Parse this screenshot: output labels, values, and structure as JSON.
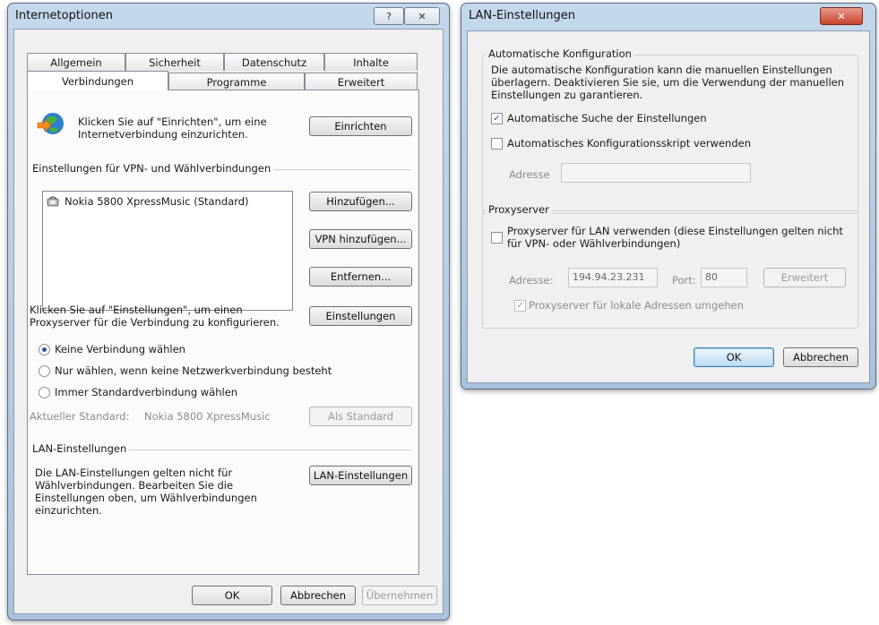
{
  "inet": {
    "title": "Internetoptionen",
    "help_glyph": "?",
    "close_glyph": "✕",
    "tabs_row1": [
      "Allgemein",
      "Sicherheit",
      "Datenschutz",
      "Inhalte"
    ],
    "tabs_row2": [
      "Verbindungen",
      "Programme",
      "Erweitert"
    ],
    "setup_text": "Klicken Sie auf \"Einrichten\", um eine Internetverbindung einzurichten.",
    "setup_button": "Einrichten",
    "vpn_group_title": "Einstellungen für VPN- und Wählverbindungen",
    "connection_item": "Nokia 5800 XpressMusic (Standard)",
    "add_button": "Hinzufügen...",
    "add_vpn_button": "VPN hinzufügen...",
    "remove_button": "Entfernen...",
    "settings_text": "Klicken Sie auf \"Einstellungen\", um einen Proxyserver für die Verbindung zu konfigurieren.",
    "settings_button": "Einstellungen",
    "radio_options": [
      "Keine Verbindung wählen",
      "Nur wählen, wenn keine Netzwerkverbindung besteht",
      "Immer Standardverbindung wählen"
    ],
    "selected_radio": 0,
    "current_default_label": "Aktueller Standard:",
    "current_default_value": "Nokia 5800 XpressMusic",
    "set_default_button": "Als Standard",
    "lan_group_title": "LAN-Einstellungen",
    "lan_text": "Die LAN-Einstellungen gelten nicht für Wählverbindungen. Bearbeiten Sie die Einstellungen oben, um Wählverbindungen einzurichten.",
    "lan_button": "LAN-Einstellungen",
    "ok_button": "OK",
    "cancel_button": "Abbrechen",
    "apply_button": "Übernehmen"
  },
  "lan": {
    "title": "LAN-Einstellungen",
    "close_glyph": "✕",
    "auto_group_title": "Automatische Konfiguration",
    "auto_text": "Die automatische Konfiguration kann die manuellen Einstellungen überlagern. Deaktivieren Sie sie, um die Verwendung der manuellen Einstellungen zu garantieren.",
    "auto_detect_label": "Automatische Suche der Einstellungen",
    "auto_detect_checked": true,
    "auto_script_label": "Automatisches Konfigurationsskript verwenden",
    "auto_script_checked": false,
    "address_label": "Adresse",
    "address_value": "",
    "proxy_group_title": "Proxyserver",
    "proxy_use_label": "Proxyserver für LAN verwenden (diese Einstellungen gelten nicht für VPN- oder Wählverbindungen)",
    "proxy_use_checked": false,
    "proxy_address_label": "Adresse:",
    "proxy_address_value": "194.94.23.231",
    "port_label": "Port:",
    "port_value": "80",
    "advanced_button": "Erweitert",
    "bypass_label": "Proxyserver für lokale Adressen umgehen",
    "bypass_checked": true,
    "ok_button": "OK",
    "cancel_button": "Abbrechen"
  }
}
